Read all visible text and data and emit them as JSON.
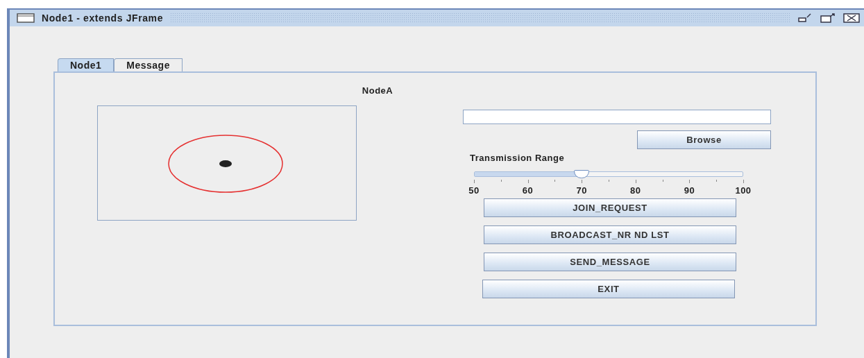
{
  "window": {
    "title": "Node1 - extends JFrame"
  },
  "tabs": [
    {
      "label": "Node1",
      "selected": true
    },
    {
      "label": "Message",
      "selected": false
    }
  ],
  "panel": {
    "heading": "NodeA",
    "browse_button": "Browse",
    "slider": {
      "label": "Transmission Range",
      "level": 0.4,
      "tick_labels": [
        "50",
        "60",
        "70",
        "80",
        "90",
        "100"
      ]
    },
    "buttons": [
      "JOIN_REQUEST",
      "BROADCAST_NR ND LST",
      "SEND_MESSAGE",
      "EXIT"
    ]
  }
}
